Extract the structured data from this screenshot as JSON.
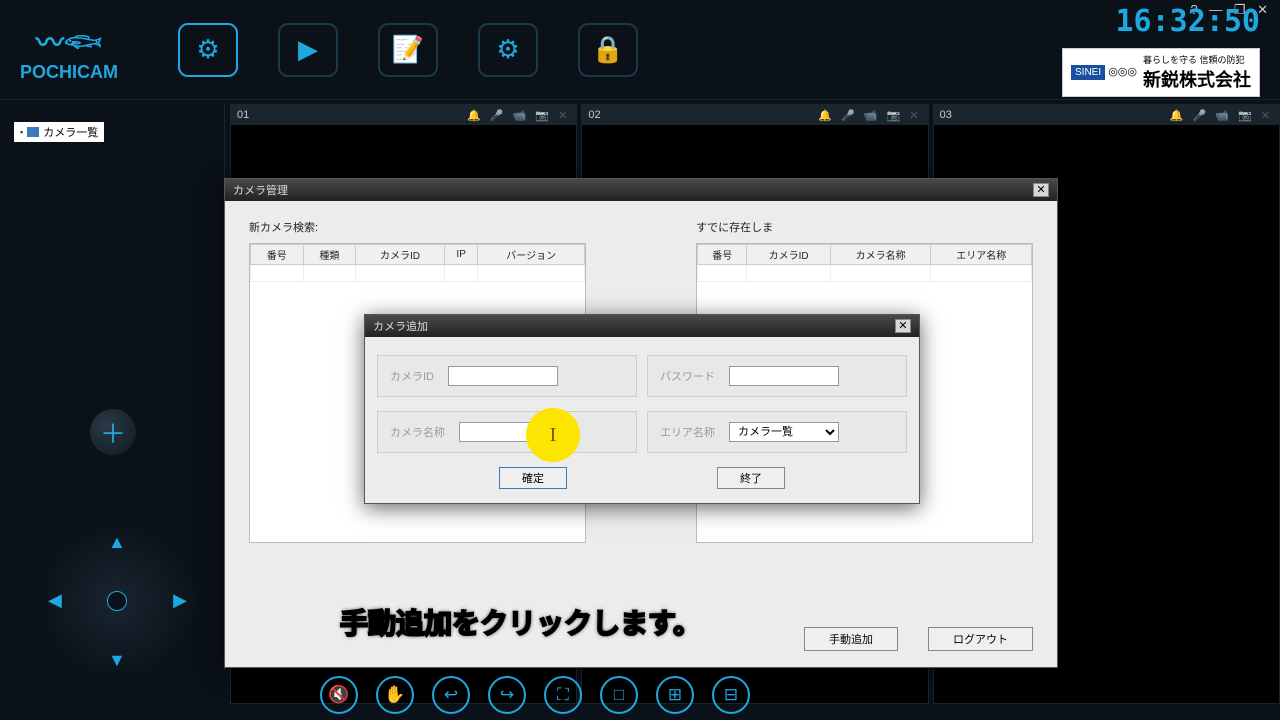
{
  "app": {
    "name": "POCHICAM"
  },
  "window_controls": "? ― ❐ ✕",
  "clock": "16:32:50",
  "banner": {
    "sinei": "SINEI",
    "tag": "暮らしを守る 信頼の防犯",
    "company": "新鋭株式会社",
    "icons": "◎◎◎"
  },
  "sidebar": {
    "root_item": "カメラ一覧"
  },
  "panes": [
    {
      "num": "01"
    },
    {
      "num": "02"
    },
    {
      "num": "03"
    }
  ],
  "pane_icons": "🔔 🎤 📹 📷 ✕",
  "cm": {
    "title": "カメラ管理",
    "search_label": "新カメラ検索:",
    "exist_label": "すでに存在しま",
    "left_cols": [
      "番号",
      "種類",
      "カメラID",
      "IP",
      "バージョン"
    ],
    "right_cols": [
      "番号",
      "カメラID",
      "カメラ名称",
      "エリア名称"
    ],
    "manual_add": "手動追加",
    "logout": "ログアウト"
  },
  "add": {
    "title": "カメラ追加",
    "camera_id": "カメラID",
    "password": "パスワード",
    "camera_name": "カメラ名称",
    "area_name": "エリア名称",
    "area_default": "カメラ一覧",
    "ok": "確定",
    "cancel": "終了"
  },
  "caption": "手動追加をクリックします。"
}
